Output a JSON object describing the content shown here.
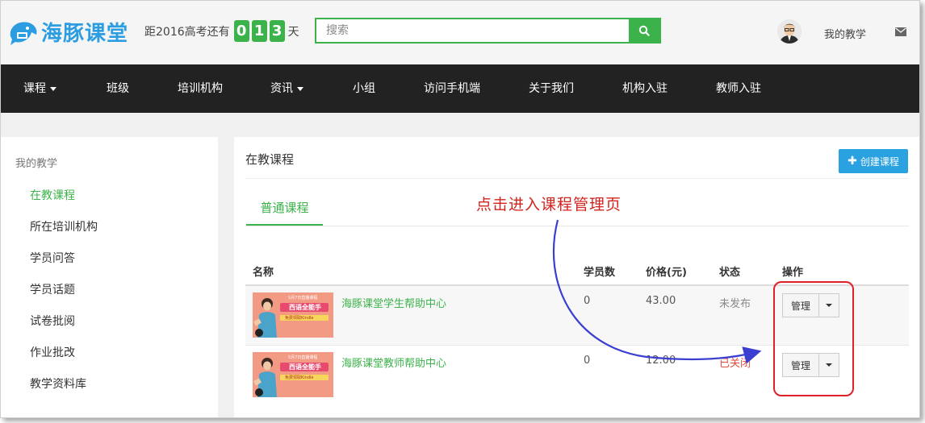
{
  "header": {
    "logo_text": "海豚课堂",
    "countdown": {
      "prefix": "距2016高考还有",
      "digits": [
        "0",
        "1",
        "3"
      ],
      "suffix": "天"
    },
    "search": {
      "placeholder": "搜索"
    },
    "user_menu": "我的教学"
  },
  "nav": {
    "items": [
      {
        "label": "课程",
        "dropdown": true
      },
      {
        "label": "班级"
      },
      {
        "label": "培训机构"
      },
      {
        "label": "资讯",
        "dropdown": true
      },
      {
        "label": "小组"
      },
      {
        "label": "访问手机端"
      },
      {
        "label": "关于我们"
      },
      {
        "label": "机构入驻"
      },
      {
        "label": "教师入驻"
      }
    ]
  },
  "sidebar": {
    "title": "我的教学",
    "items": [
      {
        "label": "在教课程",
        "active": true
      },
      {
        "label": "所在培训机构"
      },
      {
        "label": "学员问答"
      },
      {
        "label": "学员话题"
      },
      {
        "label": "试卷批阅"
      },
      {
        "label": "作业批改"
      },
      {
        "label": "教学资料库"
      }
    ]
  },
  "main": {
    "title": "在教课程",
    "create_label": "创建课程",
    "tab_label": "普通课程",
    "table": {
      "headers": [
        "名称",
        "学员数",
        "价格(元)",
        "状态",
        "操作"
      ],
      "rows": [
        {
          "name": "海豚课堂学生帮助中心",
          "students": "0",
          "price": "43.00",
          "status": "未发布",
          "action": "管理"
        },
        {
          "name": "海豚课堂教师帮助中心",
          "students": "0",
          "price": "12.00",
          "status": "已关闭",
          "action": "管理"
        }
      ]
    },
    "thumb_text": {
      "line1": "5月7日直播课程",
      "line2": "西语全能手",
      "line3": "免费领取Kindle"
    }
  },
  "annotation": {
    "text": "点击进入课程管理页"
  },
  "colors": {
    "accent_green": "#3bb34a",
    "brand_blue": "#2c9de0",
    "nav_bg": "#222222",
    "create_btn": "#2aa1e0",
    "annotation_red": "#d3231d",
    "arrow_blue": "#3a3fd0"
  }
}
